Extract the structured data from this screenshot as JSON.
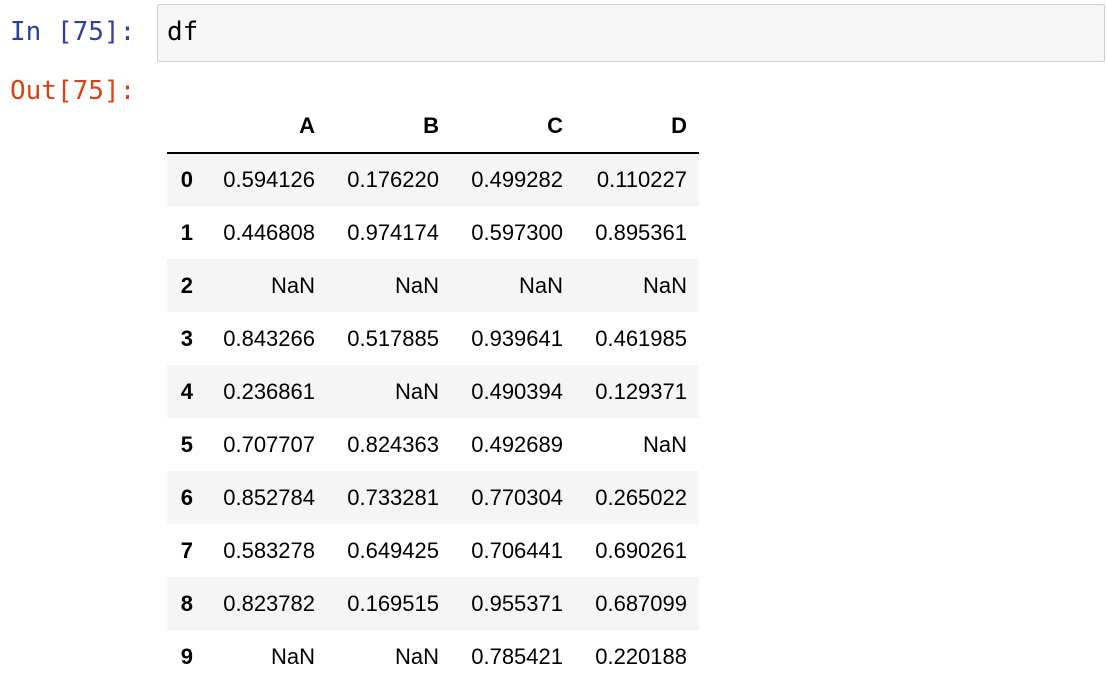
{
  "input_cell": {
    "prompt": "In [75]:",
    "code": "df"
  },
  "output_cell": {
    "prompt": "Out[75]:"
  },
  "dataframe": {
    "columns": [
      "A",
      "B",
      "C",
      "D"
    ],
    "rows": [
      {
        "index": "0",
        "values": [
          "0.594126",
          "0.176220",
          "0.499282",
          "0.110227"
        ]
      },
      {
        "index": "1",
        "values": [
          "0.446808",
          "0.974174",
          "0.597300",
          "0.895361"
        ]
      },
      {
        "index": "2",
        "values": [
          "NaN",
          "NaN",
          "NaN",
          "NaN"
        ]
      },
      {
        "index": "3",
        "values": [
          "0.843266",
          "0.517885",
          "0.939641",
          "0.461985"
        ]
      },
      {
        "index": "4",
        "values": [
          "0.236861",
          "NaN",
          "0.490394",
          "0.129371"
        ]
      },
      {
        "index": "5",
        "values": [
          "0.707707",
          "0.824363",
          "0.492689",
          "NaN"
        ]
      },
      {
        "index": "6",
        "values": [
          "0.852784",
          "0.733281",
          "0.770304",
          "0.265022"
        ]
      },
      {
        "index": "7",
        "values": [
          "0.583278",
          "0.649425",
          "0.706441",
          "0.690261"
        ]
      },
      {
        "index": "8",
        "values": [
          "0.823782",
          "0.169515",
          "0.955371",
          "0.687099"
        ]
      },
      {
        "index": "9",
        "values": [
          "NaN",
          "NaN",
          "0.785421",
          "0.220188"
        ]
      }
    ]
  }
}
